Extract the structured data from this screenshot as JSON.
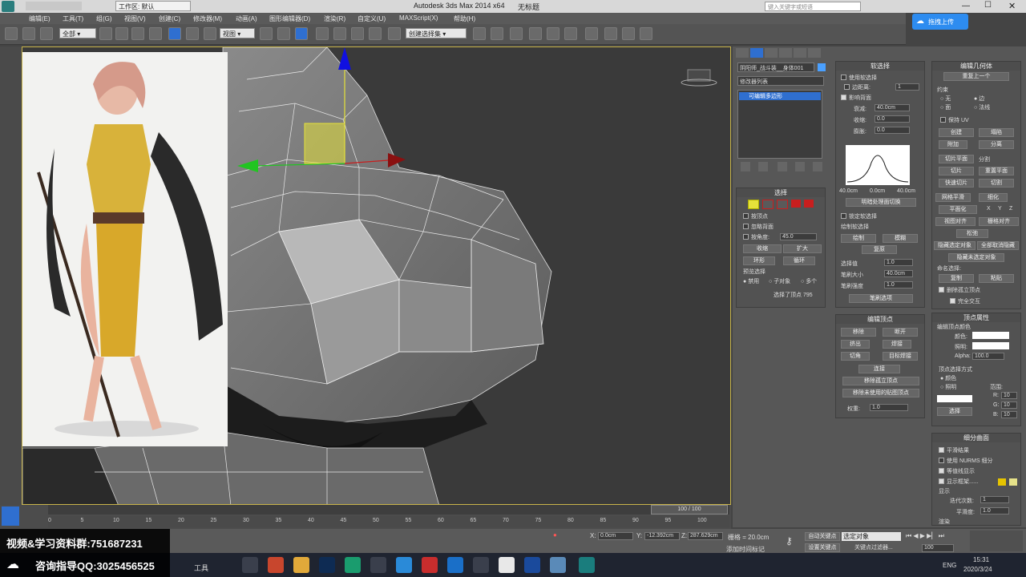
{
  "titlebar": {
    "workspace": "工作区: 默认",
    "app_title": "Autodesk 3ds Max  2014 x64",
    "doc_title": "无标题",
    "search_placeholder": "键入关键字或短语"
  },
  "menu": [
    "编辑(E)",
    "工具(T)",
    "组(G)",
    "视图(V)",
    "创建(C)",
    "修改器(M)",
    "动画(A)",
    "图形编辑器(D)",
    "渲染(R)",
    "自定义(U)",
    "MAXScript(X)",
    "帮助(H)"
  ],
  "toolbar": {
    "filter": "全部",
    "view": "视图",
    "selection_set": "创建选择集"
  },
  "cloud_upload": "拖拽上传",
  "command_panel": {
    "object_name": "阴阳师_战斗装__身体001",
    "modifier_list": "修改器列表",
    "stack_item": "可编辑多边形",
    "selection": {
      "title": "选择",
      "by_vertex": "按顶点",
      "ignore_backfacing": "忽略背面",
      "by_angle": "按角度:",
      "angle": "45.0",
      "shrink": "收缩",
      "grow": "扩大",
      "ring": "环形",
      "loop": "循环",
      "preview_selection": "预览选择",
      "disabled": "禁用",
      "subobject": "子对象",
      "multi": "多个",
      "status": "选择了顶点 795"
    },
    "soft_selection": {
      "title": "软选择",
      "use_soft": "使用软选择",
      "edge_distance": "边距离:",
      "edge_value": "1",
      "affect_backfacing": "影响背面",
      "falloff": "衰减:",
      "falloff_value": "40.0cm",
      "pinch": "收缩:",
      "pinch_value": "0.0",
      "bubble": "膨胀:",
      "bubble_value": "0.0",
      "curve_left": "40.0cm",
      "curve_mid": "0.0cm",
      "curve_right": "40.0cm",
      "shaded_face_toggle": "明暗处理面切换",
      "lock_soft": "锁定软选择",
      "paint_soft": "绘制软选择",
      "paint": "绘制",
      "blur": "模糊",
      "revert": "复原",
      "selection_value": "选择值",
      "sel_value_num": "1.0",
      "brush_size": "笔刷大小",
      "brush_size_num": "40.0cm",
      "brush_strength": "笔刷强度",
      "brush_strength_num": "1.0",
      "brush_options": "笔刷选项"
    },
    "edit_vertices": {
      "title": "编辑顶点",
      "remove": "移除",
      "break": "断开",
      "extrude": "挤出",
      "weld": "焊接",
      "chamfer": "切角",
      "target_weld": "目标焊接",
      "connect": "连接",
      "remove_isolated": "移除孤立顶点",
      "remove_unused_map": "移除未使用的贴图顶点",
      "weight": "权重:",
      "weight_value": "1.0"
    },
    "edit_geometry": {
      "title": "编辑几何体",
      "repeat_last": "重复上一个",
      "constraints": "约束",
      "none": "无",
      "edge": "边",
      "face": "面",
      "normal": "法线",
      "preserve_uv": "保持 UV",
      "create": "创建",
      "collapse": "塌陷",
      "attach": "附加",
      "detach": "分离",
      "slice_plane": "切片平面",
      "split": "分割",
      "slice": "切片",
      "reset_plane": "重置平面",
      "quickslice": "快速切片",
      "cut": "切割",
      "meshsmooth": "网格平滑",
      "tessellate": "细化",
      "make_planar": "平面化",
      "x": "X",
      "y": "Y",
      "z": "Z",
      "view_align": "视图对齐",
      "grid_align": "栅格对齐",
      "relax": "松弛",
      "hide_selected": "隐藏选定对象",
      "unhide_all": "全部取消隐藏",
      "hide_unselected": "隐藏未选定对象",
      "named_selections": "命名选择:",
      "copy": "复制",
      "paste": "粘贴",
      "delete_isolated": "删除孤立顶点",
      "full_interactivity": "完全交互"
    },
    "vertex_properties": {
      "title": "顶点属性",
      "edit_vertex_colors": "编辑顶点颜色",
      "color": "颜色:",
      "illumination": "照明:",
      "alpha": "Alpha:",
      "alpha_value": "100.0",
      "select_by": "顶点选择方式",
      "by_color": "颜色",
      "by_illum": "照明",
      "range": "范围:",
      "r": "R:",
      "g": "G:",
      "b": "B:",
      "rgb_value": "10",
      "select": "选择"
    },
    "subdivision": {
      "title": "细分曲面",
      "smooth_result": "平滑结果",
      "use_nurms": "使用 NURMS 细分",
      "isoline_display": "等值线显示",
      "show_cage": "显示框架......",
      "display": "显示",
      "iterations": "迭代次数:",
      "iterations_value": "1",
      "smoothness": "平滑度:",
      "smoothness_value": "1.0",
      "render": "渲染"
    }
  },
  "timeline": {
    "frame": "100 / 100",
    "ticks": [
      "0",
      "5",
      "10",
      "15",
      "20",
      "25",
      "30",
      "35",
      "40",
      "45",
      "50",
      "55",
      "60",
      "65",
      "70",
      "75",
      "80",
      "85",
      "90",
      "95",
      "100"
    ]
  },
  "status": {
    "x_label": "X:",
    "x_value": "0.0cm",
    "y_label": "Y:",
    "y_value": "-12.392cm",
    "z_label": "Z:",
    "z_value": "287.629cm",
    "grid": "栅格 = 20.0cm",
    "add_time_tag": "添加时间标记",
    "auto_key": "自动关键点",
    "set_key": "设置关键点",
    "selected": "选定对象",
    "key_filters": "关键点过滤器...",
    "frame_value": "100"
  },
  "overlay": {
    "line1": "视频&学习资料群:751687231",
    "line2": "咨询指导QQ:3025456525"
  },
  "taskbar": {
    "tools": "工具",
    "lang": "ENG",
    "time": "15:31",
    "date": "2020/3/24"
  },
  "colors": {
    "viewport_border": "#c8b44a",
    "highlight_blue": "#2f6fd0",
    "gizmo_yellow": "#e6e23a",
    "gizmo_red": "#c81e1e",
    "gizmo_green": "#22c422",
    "gizmo_blue": "#1010e0"
  }
}
